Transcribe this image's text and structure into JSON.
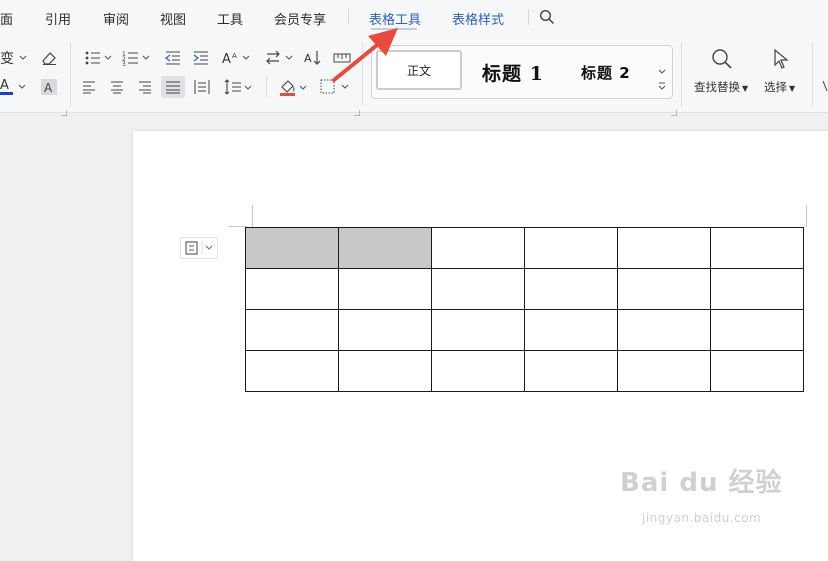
{
  "tabs": [
    {
      "label": "面",
      "active": false
    },
    {
      "label": "引用",
      "active": false
    },
    {
      "label": "审阅",
      "active": false
    },
    {
      "label": "视图",
      "active": false
    },
    {
      "label": "工具",
      "active": false
    },
    {
      "label": "会员专享",
      "active": false
    },
    {
      "label": "表格工具",
      "active": true
    },
    {
      "label": "表格样式",
      "active": false
    }
  ],
  "styles": {
    "normal": "正文",
    "heading1": "标题 1",
    "heading2": "标题 2"
  },
  "buttons": {
    "find_replace": "查找替换",
    "select": "选择"
  },
  "table": {
    "rows": 4,
    "cols": 6,
    "selected_cells": [
      [
        0,
        0
      ],
      [
        0,
        1
      ]
    ]
  },
  "watermark": {
    "main": "Bai du 经验",
    "sub": "jingyan.baidu.com"
  },
  "colors": {
    "accent_tab": "#2f5fc2",
    "annotation_arrow": "#e84b3c",
    "selected_cell": "#c8c8c8"
  }
}
